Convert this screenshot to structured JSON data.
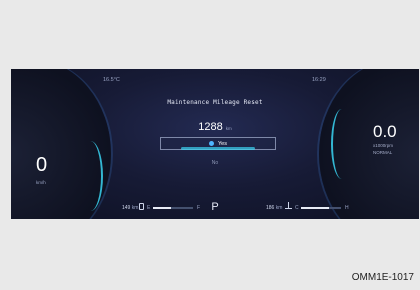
{
  "status": {
    "outside_temp": "16.5°C",
    "clock": "16:29"
  },
  "dialog": {
    "title": "Maintenance Mileage Reset",
    "mileage_value": "1288",
    "mileage_unit": "km",
    "option_yes": "Yes",
    "option_no": "No"
  },
  "speedometer": {
    "value": "0",
    "unit": "km/h"
  },
  "tachometer": {
    "value": "0.0",
    "unit": "x1000rpm",
    "mode": "NORMAL"
  },
  "bottom_bar": {
    "fuel_range_value": "149",
    "fuel_range_unit": "km",
    "fuel_empty_label": "E",
    "fuel_full_label": "F",
    "fuel_level_percent": 45,
    "gear": "P",
    "second_range_value": "186",
    "second_range_unit": "km",
    "temp_cold_label": "C",
    "temp_hot_label": "H",
    "temp_level_percent": 70
  },
  "figure_code": "OMM1E-1017",
  "colors": {
    "accent": "#3ad4f2",
    "selection_dot": "#4fb6ff",
    "background": "#171b36"
  }
}
